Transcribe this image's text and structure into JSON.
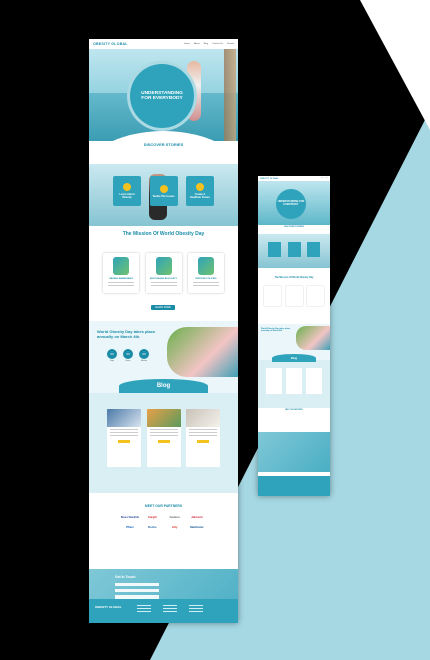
{
  "brand": {
    "logo": "OBESITY GLOBAL"
  },
  "nav": {
    "links": [
      "Home",
      "About",
      "Blog",
      "Contact Us",
      "Donate"
    ]
  },
  "hero": {
    "title": "UNDERSTANDING FOR EVERYBODY"
  },
  "discover": {
    "title": "DISCOVER STORIES"
  },
  "stories": {
    "cards": [
      "Learn About Obesity",
      "Tackle The Issues",
      "Create A Healthier Future"
    ]
  },
  "mission": {
    "title": "The Mission Of World Obesity Day",
    "cards": [
      "RAISING AWARENESS",
      "ENCOURAGE ADVOCACY",
      "IMPROVE POLICIES"
    ],
    "button": "LEARN MORE"
  },
  "wod": {
    "title": "World Obesity Day takes place annually on March 4th.",
    "countdown": [
      {
        "value": "00",
        "label": "Days"
      },
      {
        "value": "00",
        "label": "Hours"
      },
      {
        "value": "00",
        "label": "Minutes"
      }
    ]
  },
  "blog": {
    "title": "Blog"
  },
  "partners": {
    "title": "MEET OUR PARTNERS",
    "logos": [
      "Novo Nordisk",
      "Cargill",
      "Lilly",
      "Medtronic",
      "Pfizer",
      "Roche",
      "Gedeon",
      "Johnson"
    ]
  },
  "touch": {
    "title": "Get In Touch"
  },
  "colors": {
    "primary": "#2fa3bb",
    "accent": "#f4c21f",
    "backdrop": "#a5d8e3"
  }
}
